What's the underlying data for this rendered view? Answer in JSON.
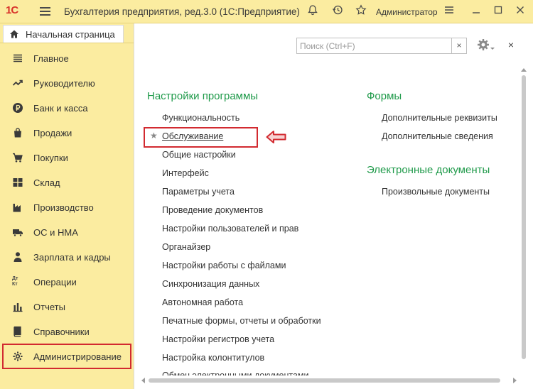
{
  "titlebar": {
    "logo": "1С",
    "title": "Бухгалтерия предприятия, ред.3.0  (1С:Предприятие)",
    "user": "Администратор",
    "icons": [
      "menu-icon",
      "bell-icon",
      "history-icon",
      "star-icon",
      "settings-lines-icon",
      "minimize-icon",
      "maximize-icon",
      "close-icon"
    ]
  },
  "home_tab": {
    "label": "Начальная страница"
  },
  "sidebar": {
    "items": [
      {
        "label": "Главное",
        "icon": "menu-lines-icon"
      },
      {
        "label": "Руководителю",
        "icon": "trend-icon"
      },
      {
        "label": "Банк и касса",
        "icon": "ruble-icon"
      },
      {
        "label": "Продажи",
        "icon": "shopping-bag-icon"
      },
      {
        "label": "Покупки",
        "icon": "cart-icon"
      },
      {
        "label": "Склад",
        "icon": "warehouse-icon"
      },
      {
        "label": "Производство",
        "icon": "factory-icon"
      },
      {
        "label": "ОС и НМА",
        "icon": "truck-icon"
      },
      {
        "label": "Зарплата и кадры",
        "icon": "person-icon"
      },
      {
        "label": "Операции",
        "icon": "debit-credit-icon",
        "icon_text": "Дт Кт"
      },
      {
        "label": "Отчеты",
        "icon": "bar-chart-icon"
      },
      {
        "label": "Справочники",
        "icon": "book-icon"
      },
      {
        "label": "Администрирование",
        "icon": "gear-icon"
      }
    ]
  },
  "main": {
    "search_placeholder": "Поиск (Ctrl+F)",
    "search_clear": "×",
    "close": "×",
    "left_section": {
      "title": "Настройки программы",
      "links": [
        "Функциональность",
        "Обслуживание",
        "Общие настройки",
        "Интерфейс",
        "Параметры учета",
        "Проведение документов",
        "Настройки пользователей и прав",
        "Органайзер",
        "Настройки работы с файлами",
        "Синхронизация данных",
        "Автономная работа",
        "Печатные формы, отчеты и обработки",
        "Настройки регистров учета",
        "Настройка колонтитулов"
      ],
      "cutoff_link": "Обмен электронными документами"
    },
    "forms_section": {
      "title": "Формы",
      "links": [
        "Дополнительные реквизиты",
        "Дополнительные сведения"
      ]
    },
    "edocs_section": {
      "title": "Электронные документы",
      "links": [
        "Произвольные документы"
      ]
    }
  },
  "colors": {
    "sidebar_bg": "#fbeca0",
    "section_title": "#1f9a4a",
    "highlight": "#d22a30",
    "logo": "#d8322a"
  }
}
